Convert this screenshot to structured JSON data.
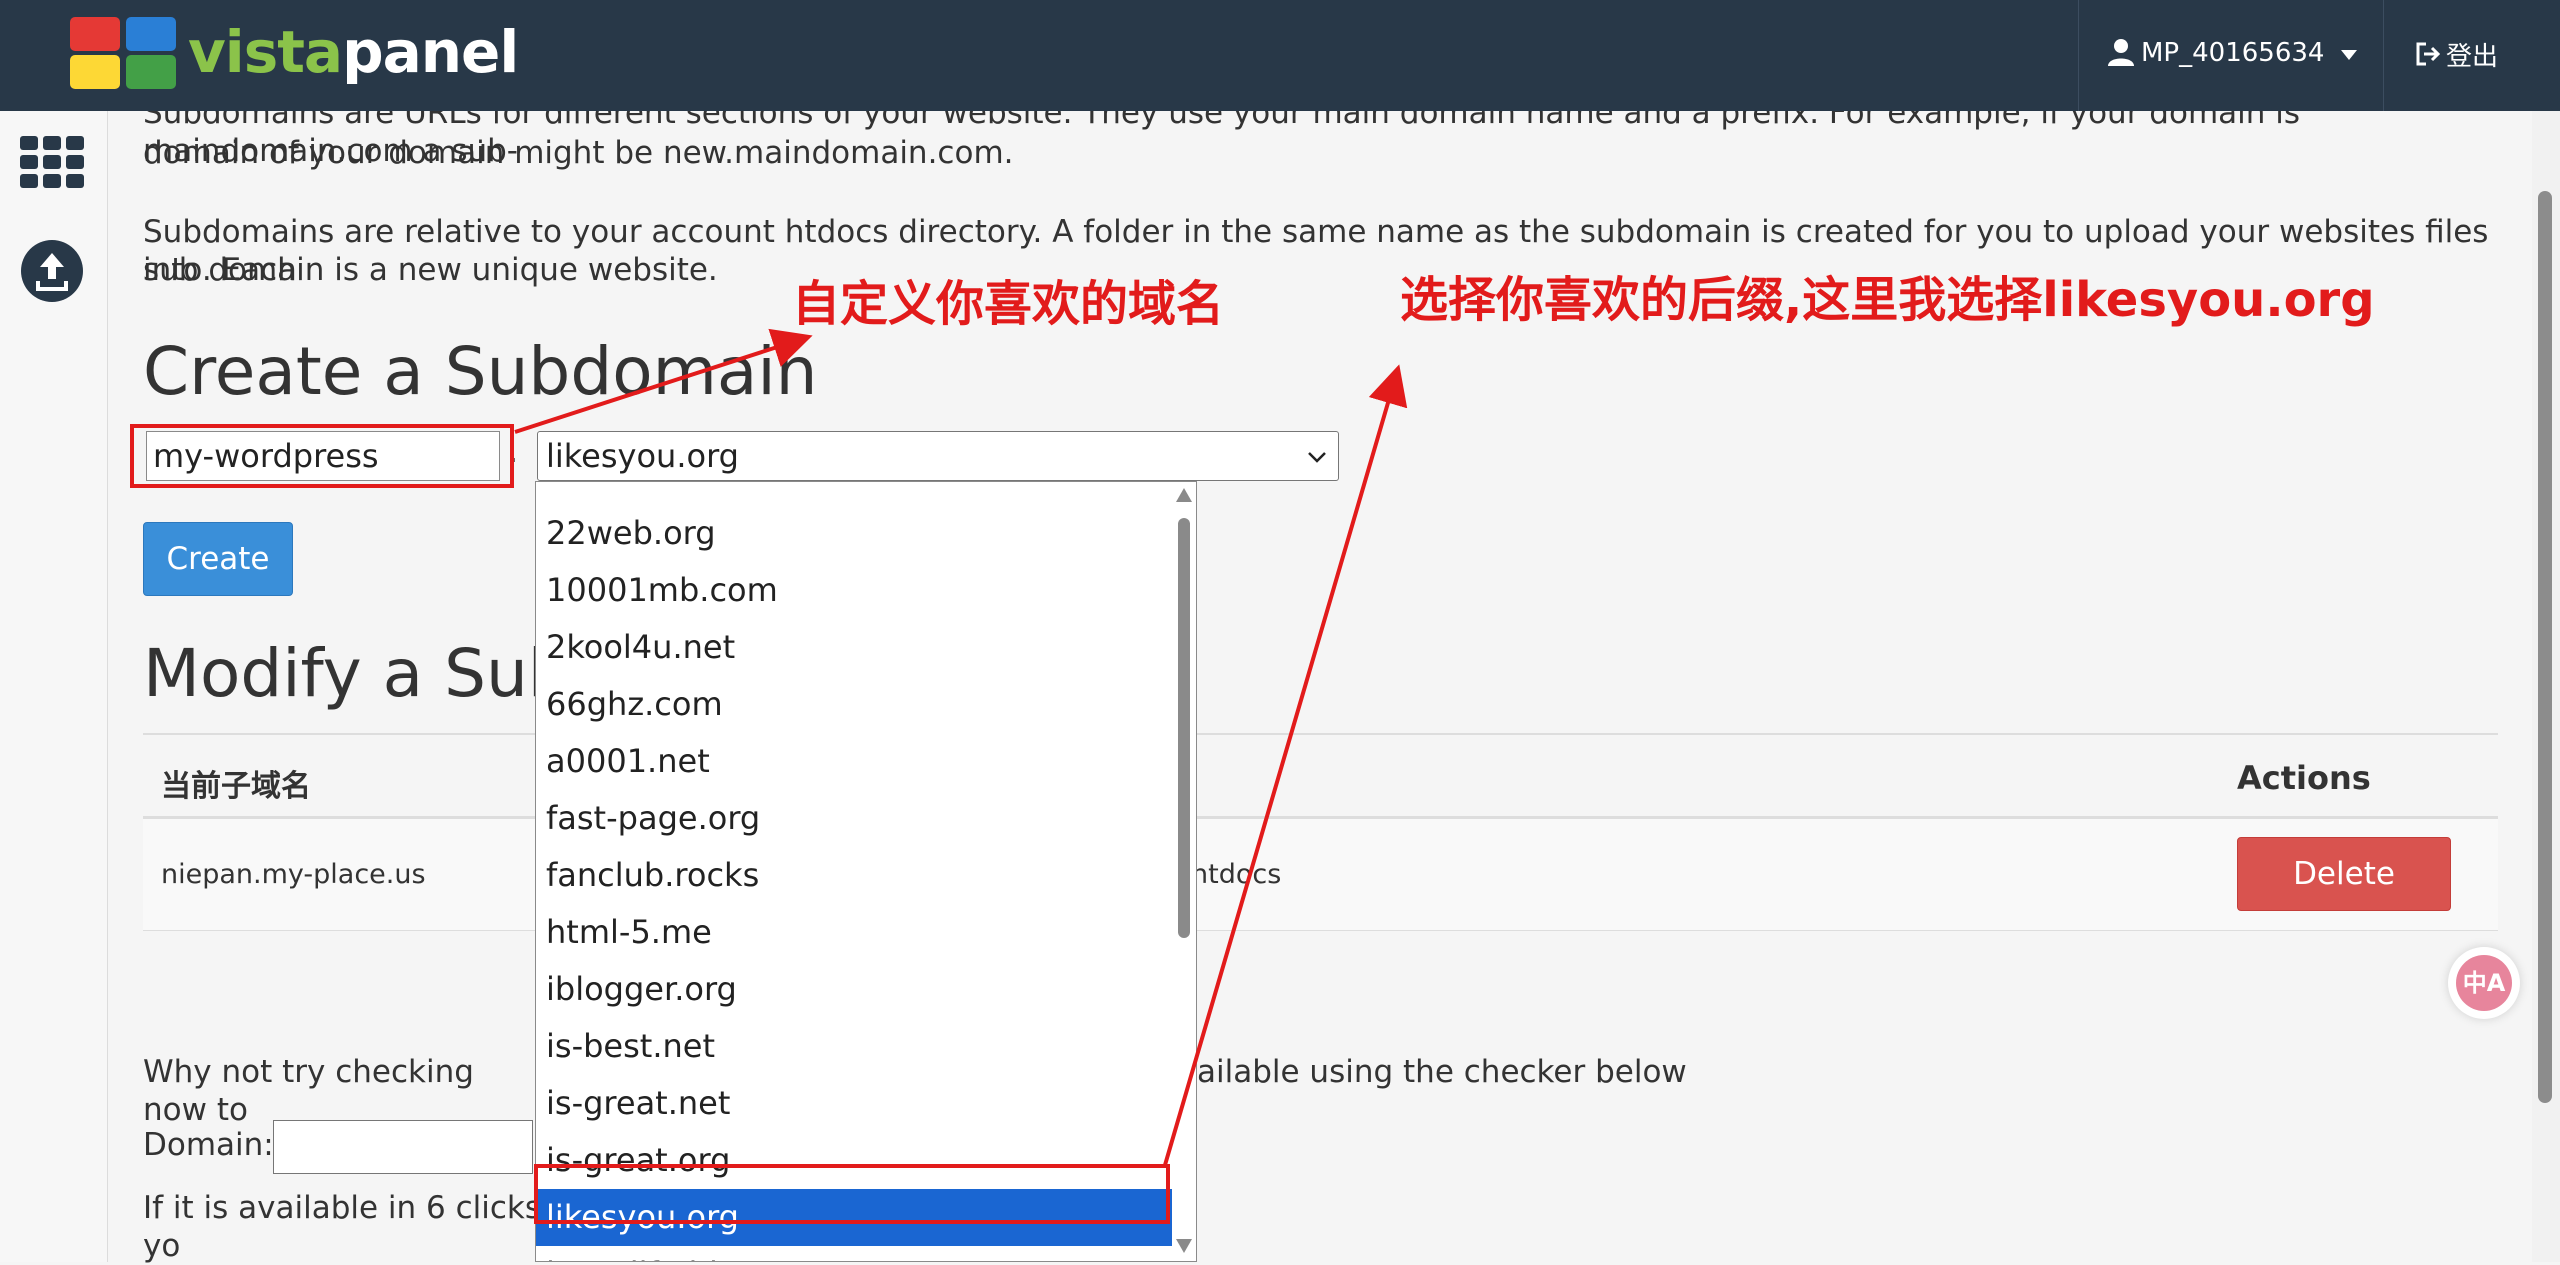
{
  "header": {
    "logo_text_a": "vista",
    "logo_text_b": "panel",
    "username": "MP_40165634",
    "logout_label": "登出"
  },
  "intro": {
    "para1_line1": "Subdomains are URLs for different sections of your website. They use your main domain name and a prefix. For example, if your domain is maindomain.com a sub-",
    "para1_line2": "domain of your domain might be new.maindomain.com.",
    "para2_line1": "Subdomains are relative to your account htdocs directory. A folder in the same name as the subdomain is created for you to upload your websites files into. Each",
    "para2_line2": "sub domain is a new unique website."
  },
  "create": {
    "heading": "Create a Subdomain",
    "subdomain_value": "my-wordpress",
    "separator": ".",
    "selected_domain": "likesyou.org",
    "button_label": "Create"
  },
  "dropdown": {
    "options": [
      "22web.org",
      "10001mb.com",
      "2kool4u.net",
      "66ghz.com",
      "a0001.net",
      "fast-page.org",
      "fanclub.rocks",
      "html-5.me",
      "iblogger.org",
      "is-best.net",
      "is-great.net",
      "is-great.org",
      "likesyou.org",
      "loveslife.biz"
    ],
    "selected_index": 12
  },
  "modify": {
    "heading": "Modify a Sub",
    "col_subdomain": "当前子域名",
    "col_actions": "Actions",
    "rows": [
      {
        "subdomain": "niepan.my-place.us",
        "path_tail": "htdocs",
        "action": "Delete"
      }
    ]
  },
  "checker": {
    "text_a": "Why not try checking now to",
    "text_b": "ailable using the checker below",
    "domain_label": "Domain:",
    "hint_text": "If it is available in 6 clicks yo"
  },
  "annotations": {
    "custom_label": "自定义你喜欢的域名",
    "suffix_label": "选择你喜欢的后缀,这里我选择likesyou.org",
    "color": "#e21b1b"
  },
  "translate_badge": "中A"
}
